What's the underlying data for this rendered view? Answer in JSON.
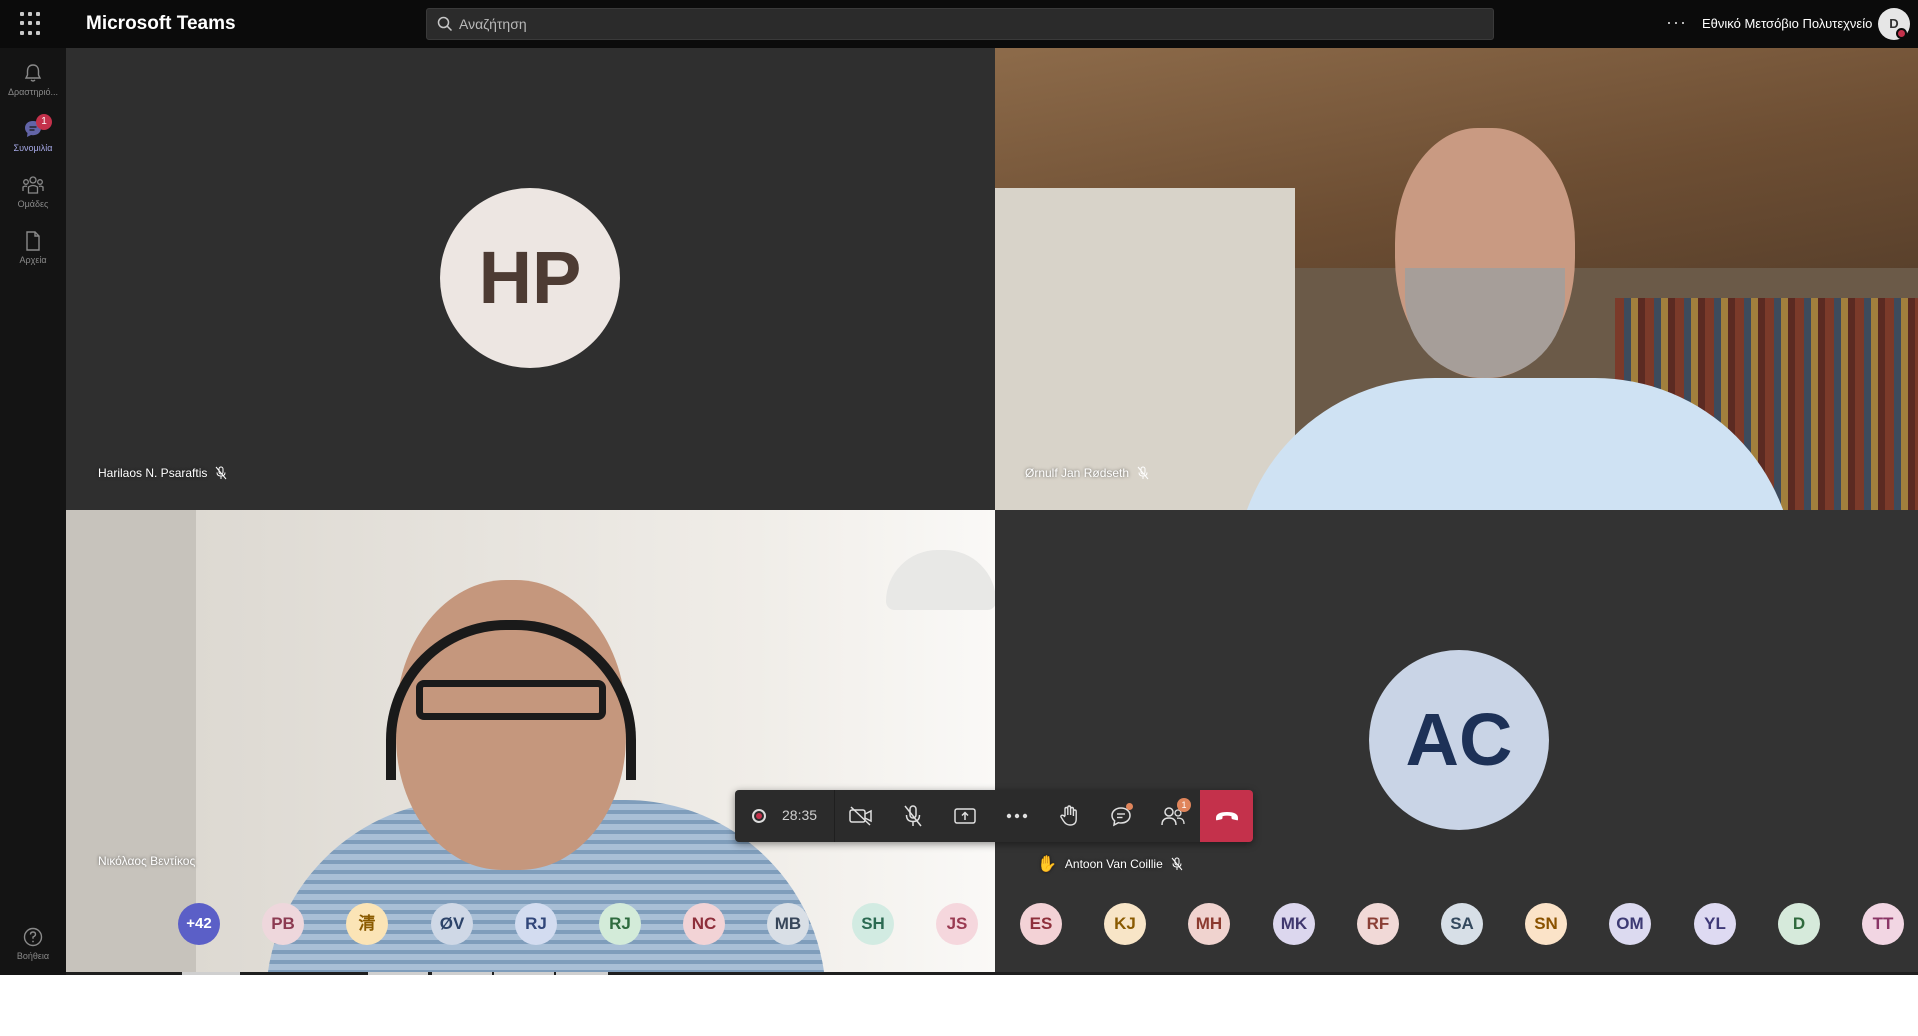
{
  "app": {
    "title": "Microsoft Teams",
    "search_placeholder": "Αναζήτηση",
    "more_label": "···",
    "org_name": "Εθνικό Μετσόβιο Πολυτεχνείο",
    "me_initial": "D"
  },
  "rail": {
    "items": [
      {
        "label": "Δραστηριό...",
        "icon": "bell-icon"
      },
      {
        "label": "Συνομιλία",
        "icon": "chat-icon",
        "badge": "1",
        "active": true
      },
      {
        "label": "Ομάδες",
        "icon": "teams-icon"
      },
      {
        "label": "Αρχεία",
        "icon": "file-icon"
      }
    ],
    "help_label": "Βοήθεια"
  },
  "tiles": [
    {
      "name": "Harilaos N. Psaraftis",
      "initials": "HP",
      "muted": true,
      "video": false
    },
    {
      "name": "Ørnulf Jan Rødseth",
      "muted": true,
      "video": true
    },
    {
      "name": "Νικόλαος Βεντίκος",
      "muted": false,
      "video": true
    },
    {
      "name": "Antoon Van Coillie",
      "initials": "AC",
      "muted": true,
      "video": false,
      "hand_raised": true
    }
  ],
  "controls": {
    "timer": "28:35",
    "participants_badge": "1",
    "colors": {
      "hangup": "#c4314b",
      "accent": "#6264a7"
    }
  },
  "participants": [
    {
      "initials": "+42",
      "bg": "#5b5fc7",
      "fg": "#ffffff"
    },
    {
      "initials": "PB",
      "bg": "#eed7dc",
      "fg": "#8c3b52"
    },
    {
      "initials": "清",
      "bg": "#fbe4b6",
      "fg": "#8a5a00"
    },
    {
      "initials": "ØV",
      "bg": "#cfd8e6",
      "fg": "#2c4369"
    },
    {
      "initials": "RJ",
      "bg": "#d3dcf0",
      "fg": "#31467a"
    },
    {
      "initials": "RJ",
      "bg": "#d3ebd9",
      "fg": "#2e6b3e"
    },
    {
      "initials": "NC",
      "bg": "#f2d3d6",
      "fg": "#8e2f3b"
    },
    {
      "initials": "MB",
      "bg": "#d9dfe6",
      "fg": "#37465a"
    },
    {
      "initials": "SH",
      "bg": "#d2ebe2",
      "fg": "#2b6a52"
    },
    {
      "initials": "JS",
      "bg": "#f5d7dd",
      "fg": "#9a3b52"
    },
    {
      "initials": "ES",
      "bg": "#f3d2d6",
      "fg": "#8e2f3b"
    },
    {
      "initials": "KJ",
      "bg": "#f8e5c7",
      "fg": "#8a5a00"
    },
    {
      "initials": "MH",
      "bg": "#f0d3cf",
      "fg": "#8b3a2f"
    },
    {
      "initials": "MK",
      "bg": "#dcd7ee",
      "fg": "#40386f"
    },
    {
      "initials": "RF",
      "bg": "#f1d9d7",
      "fg": "#8a3f36"
    },
    {
      "initials": "SA",
      "bg": "#d7dfe7",
      "fg": "#34495e"
    },
    {
      "initials": "SN",
      "bg": "#fbe3c8",
      "fg": "#8a5200"
    },
    {
      "initials": "OM",
      "bg": "#dcdaf0",
      "fg": "#3d3a74"
    },
    {
      "initials": "YL",
      "bg": "#dedaf2",
      "fg": "#3e3877"
    },
    {
      "initials": "D",
      "bg": "#d6eadb",
      "fg": "#2f6a3d"
    },
    {
      "initials": "TT",
      "bg": "#f2d6e3",
      "fg": "#8a3566"
    }
  ]
}
